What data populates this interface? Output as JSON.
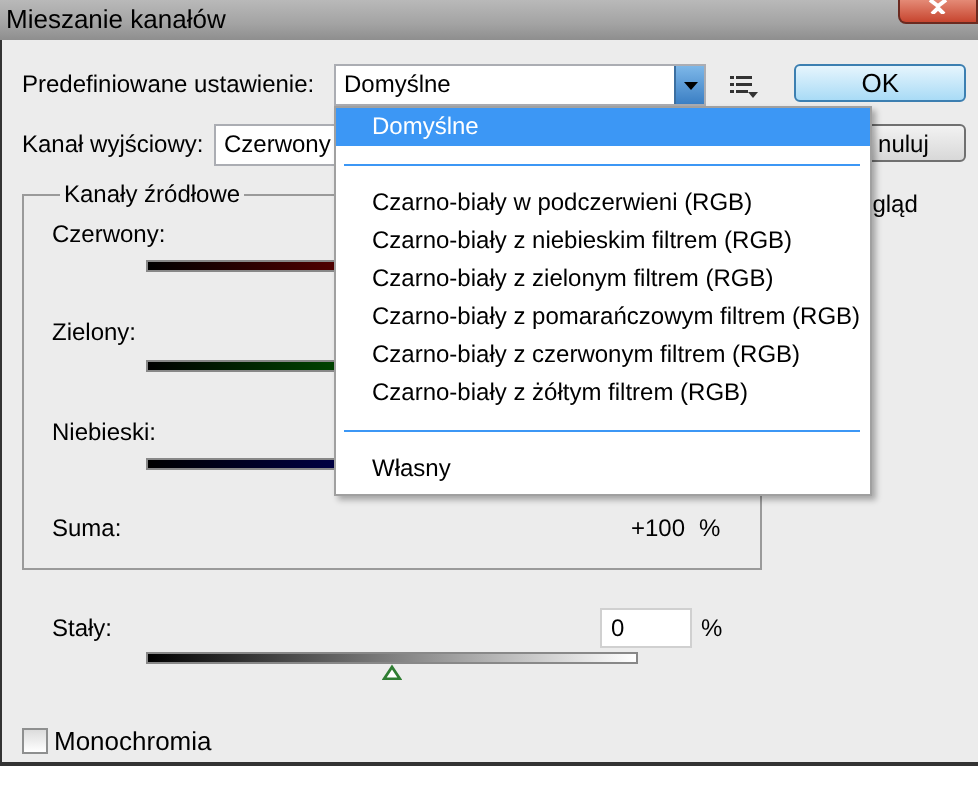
{
  "window": {
    "title": "Mieszanie kanałów"
  },
  "preset": {
    "label": "Predefiniowane ustawienie:",
    "value": "Domyślne"
  },
  "buttons": [
    {
      "label": "OK",
      "kind": "default"
    },
    {
      "label": "nuluj",
      "kind": "normal"
    }
  ],
  "output_channel": {
    "label": "Kanał wyjściowy:",
    "value": "Czerwony"
  },
  "preview": {
    "label": "gląd"
  },
  "source_channels": {
    "title": "Kanały źródłowe",
    "channels": [
      {
        "name": "Czerwony:"
      },
      {
        "name": "Zielony:"
      },
      {
        "name": "Niebieski:"
      }
    ],
    "sum_label": "Suma:",
    "sum_value": "+100",
    "sum_unit": "%"
  },
  "constant": {
    "label": "Stały:",
    "value": "0",
    "unit": "%",
    "level": 0.5
  },
  "monochrome": {
    "label": "Monochromia",
    "checked": false
  },
  "preset_menu": {
    "items": [
      {
        "kind": "item",
        "label": "Domyślne",
        "selected": true
      },
      {
        "kind": "separator"
      },
      {
        "kind": "item",
        "label": "Czarno-biały w podczerwieni (RGB)",
        "selected": false
      },
      {
        "kind": "item",
        "label": "Czarno-biały z niebieskim filtrem (RGB)",
        "selected": false
      },
      {
        "kind": "item",
        "label": "Czarno-biały z zielonym filtrem (RGB)",
        "selected": false
      },
      {
        "kind": "item",
        "label": "Czarno-biały z pomarańczowym filtrem (RGB)",
        "selected": false
      },
      {
        "kind": "item",
        "label": "Czarno-biały z czerwonym filtrem (RGB)",
        "selected": false
      },
      {
        "kind": "item",
        "label": "Czarno-biały z żółtym filtrem (RGB)",
        "selected": false
      },
      {
        "kind": "separator"
      },
      {
        "kind": "item",
        "label": "Własny",
        "selected": false
      }
    ]
  }
}
